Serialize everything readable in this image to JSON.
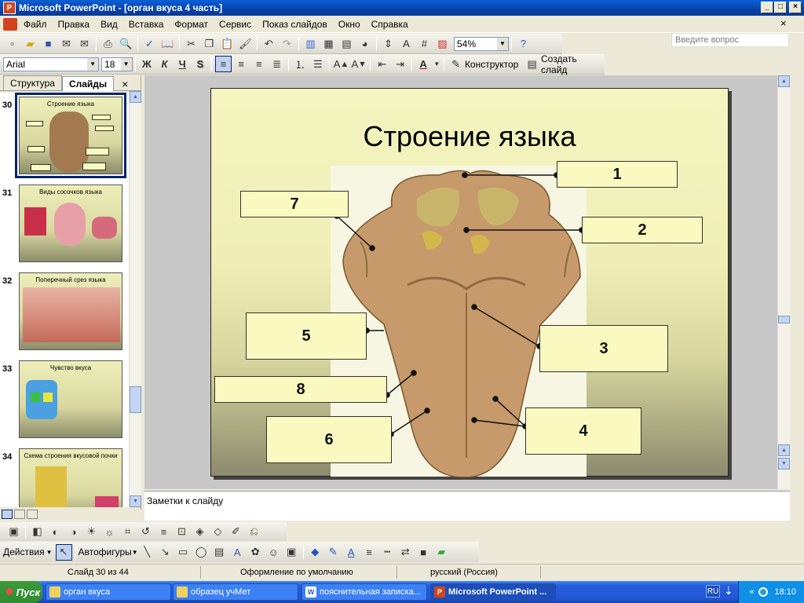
{
  "window": {
    "title": "Microsoft PowerPoint - [орган вкуса 4 часть]"
  },
  "menu": {
    "items": [
      "Файл",
      "Правка",
      "Вид",
      "Вставка",
      "Формат",
      "Сервис",
      "Показ слайдов",
      "Окно",
      "Справка"
    ],
    "ask_placeholder": "Введите вопрос"
  },
  "toolbar": {
    "zoom": "54%",
    "font": "Arial",
    "size": "18",
    "bold": "Ж",
    "italic": "К",
    "underline": "Ч",
    "shadow": "S",
    "designer": "Конструктор",
    "new_slide": "Создать слайд"
  },
  "pane": {
    "tabs": [
      "Структура",
      "Слайды"
    ],
    "thumbs": [
      {
        "num": "30",
        "title": "Строение языка"
      },
      {
        "num": "31",
        "title": "Виды сосочков языка"
      },
      {
        "num": "32",
        "title": "Поперечный срез языка"
      },
      {
        "num": "33",
        "title": "Чувство вкуса"
      },
      {
        "num": "34",
        "title": "Схема строения вкусовой почки"
      }
    ]
  },
  "slide": {
    "title": "Строение языка",
    "labels": [
      "1",
      "2",
      "3",
      "4",
      "5",
      "6",
      "7",
      "8"
    ]
  },
  "notes": {
    "placeholder": "Заметки к слайду"
  },
  "drawing": {
    "actions": "Действия",
    "autoshapes": "Автофигуры"
  },
  "status": {
    "slide": "Слайд 30 из 44",
    "design": "Оформление по умолчанию",
    "lang": "русский (Россия)"
  },
  "taskbar": {
    "start": "Пуск",
    "tasks": [
      "орган вкуса",
      "образец учМет",
      "пояснительная записка...",
      "Microsoft PowerPoint ..."
    ],
    "lang": "RU",
    "time": "18:10"
  },
  "colors": {
    "titlebar": "#0842a8",
    "slide_bg": "#eeeeb6",
    "label_bg": "#fafac0"
  }
}
